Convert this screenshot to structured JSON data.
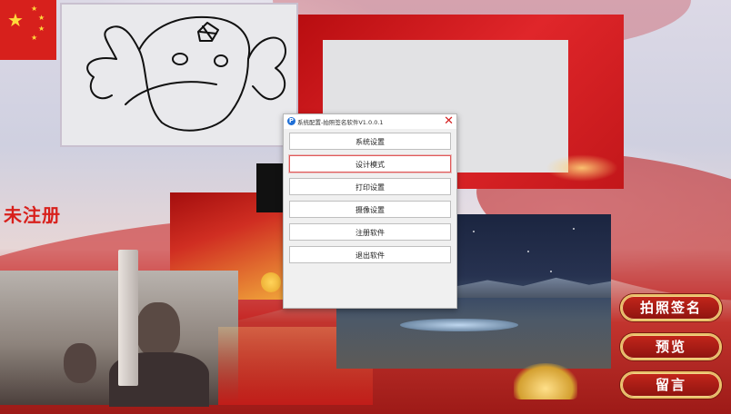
{
  "status_text": "未注册",
  "dialog": {
    "title": "系统配置-拍照签名软件V1.0.0.1",
    "app_icon": "app-logo-icon",
    "close_icon": "close-icon",
    "items": [
      {
        "label": "系统设置",
        "active": false
      },
      {
        "label": "设计模式",
        "active": true
      },
      {
        "label": "打印设置",
        "active": false
      },
      {
        "label": "摄像设置",
        "active": false
      },
      {
        "label": "注册软件",
        "active": false
      },
      {
        "label": "退出软件",
        "active": false
      }
    ]
  },
  "actions": {
    "sign_label": "拍照签名",
    "preview_label": "预览",
    "message_label": "留言"
  },
  "colors": {
    "brand_red": "#d8201c",
    "gold": "#e9c16a",
    "close_red": "#d42020"
  }
}
